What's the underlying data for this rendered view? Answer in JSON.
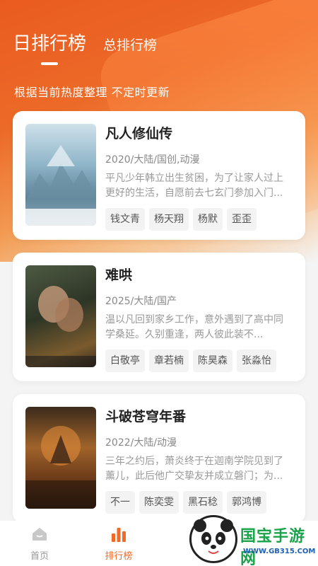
{
  "header": {
    "tab_daily": "日排行榜",
    "tab_total": "总排行榜",
    "subtitle": "根据当前热度整理 不定时更新"
  },
  "items": [
    {
      "title": "凡人修仙传",
      "meta": "2020/大陆/国创,动漫",
      "desc": "平凡少年韩立出生贫困，为了让家人过上更好的生活，自愿前去七玄门参加入门...",
      "tags": [
        "钱文青",
        "杨天翔",
        "杨默",
        "歪歪"
      ],
      "poster_icon": "poster-image"
    },
    {
      "title": "难哄",
      "meta": "2025/大陆/国产",
      "desc": "温以凡回到家乡工作，意外遇到了高中同学桑延。久别重逢，两人彼此装不...",
      "tags": [
        "白敬亭",
        "章若楠",
        "陈昊森",
        "张淼怡"
      ],
      "poster_icon": "poster-image"
    },
    {
      "title": "斗破苍穹年番",
      "meta": "2022/大陆/动漫",
      "desc": "三年之约后，萧炎终于在迦南学院见到了薰儿，此后他广交挚友并成立磐门；为...",
      "tags": [
        "不一",
        "陈奕雯",
        "黑石稔",
        "郭鸿博"
      ],
      "poster_icon": "poster-image"
    }
  ],
  "nav": {
    "home_label": "首页",
    "rank_label": "排行榜",
    "home_icon": "home-icon",
    "rank_icon": "bar-chart-icon"
  },
  "watermark": {
    "text": "国宝手游网",
    "url": "WWW.GB315.COM"
  },
  "colors": {
    "accent": "#f26a25",
    "hero_top": "#ea5b20",
    "card_bg": "#ffffff",
    "tag_bg": "#f3f3f3"
  }
}
